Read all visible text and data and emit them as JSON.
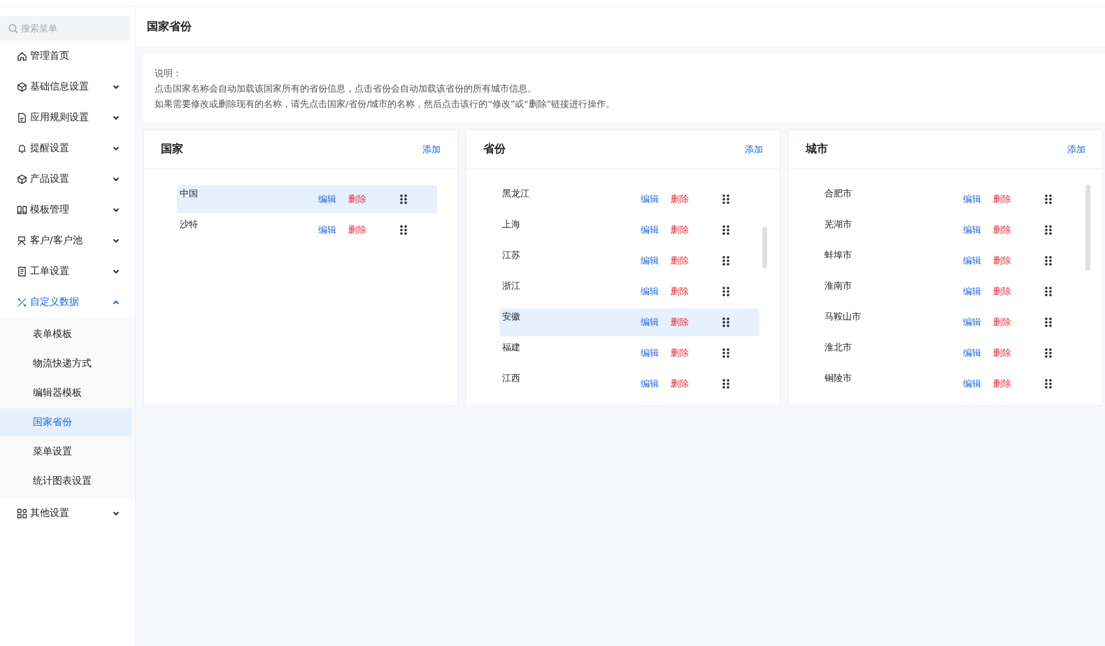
{
  "search": {
    "placeholder": "搜索菜单"
  },
  "menu": [
    {
      "label": "管理首页",
      "kind": "link",
      "selected": false
    },
    {
      "label": "基础信息设置",
      "kind": "group",
      "selected": false,
      "expanded": false
    },
    {
      "label": "应用规则设置",
      "kind": "group",
      "selected": false,
      "expanded": false
    },
    {
      "label": "提醒设置",
      "kind": "group",
      "selected": false,
      "expanded": false
    },
    {
      "label": "产品设置",
      "kind": "group",
      "selected": false,
      "expanded": false
    },
    {
      "label": "模板管理",
      "kind": "group",
      "selected": false,
      "expanded": false
    },
    {
      "label": "客户/客户池",
      "kind": "group",
      "selected": false,
      "expanded": false
    },
    {
      "label": "工单设置",
      "kind": "group",
      "selected": false,
      "expanded": false
    },
    {
      "label": "自定义数据",
      "kind": "group",
      "selected": true,
      "expanded": true,
      "children": [
        {
          "label": "表单模板",
          "selected": false
        },
        {
          "label": "物流快递方式",
          "selected": false
        },
        {
          "label": "编辑器模板",
          "selected": false
        },
        {
          "label": "国家省份",
          "selected": true
        },
        {
          "label": "菜单设置",
          "selected": false
        },
        {
          "label": "统计图表设置",
          "selected": false
        }
      ]
    },
    {
      "label": "其他设置",
      "kind": "group",
      "selected": false,
      "expanded": false
    }
  ],
  "page_title": "国家省份",
  "notice": {
    "title": "说明：",
    "lines": [
      "点击国家名称会自动加载该国家所有的省份信息，点击省份会自动加载该省份的所有城市信息。",
      "如果需要修改或删除现有的名称，请先点击国家/省份/城市的名称，然后点击该行的“修改”或“删除”链接进行操作。"
    ]
  },
  "panels": [
    {
      "title": "国家",
      "add": "添加",
      "scrollbar": false,
      "rows": [
        {
          "name": "中国",
          "edit": "编辑",
          "delete": "删除",
          "selected": true
        },
        {
          "name": "沙特",
          "edit": "编辑",
          "delete": "删除",
          "selected": false
        }
      ]
    },
    {
      "title": "省份",
      "add": "添加",
      "scrollbar": true,
      "rows": [
        {
          "name": "黑龙江",
          "edit": "编辑",
          "delete": "删除",
          "selected": false
        },
        {
          "name": "上海",
          "edit": "编辑",
          "delete": "删除",
          "selected": false
        },
        {
          "name": "江苏",
          "edit": "编辑",
          "delete": "删除",
          "selected": false
        },
        {
          "name": "浙江",
          "edit": "编辑",
          "delete": "删除",
          "selected": false
        },
        {
          "name": "安徽",
          "edit": "编辑",
          "delete": "删除",
          "selected": true
        },
        {
          "name": "福建",
          "edit": "编辑",
          "delete": "删除",
          "selected": false
        },
        {
          "name": "江西",
          "edit": "编辑",
          "delete": "删除",
          "selected": false
        }
      ]
    },
    {
      "title": "城市",
      "add": "添加",
      "scrollbar": true,
      "rows": [
        {
          "name": "合肥市",
          "edit": "编辑",
          "delete": "删除",
          "selected": false
        },
        {
          "name": "芜湖市",
          "edit": "编辑",
          "delete": "删除",
          "selected": false
        },
        {
          "name": "蚌埠市",
          "edit": "编辑",
          "delete": "删除",
          "selected": false
        },
        {
          "name": "淮南市",
          "edit": "编辑",
          "delete": "删除",
          "selected": false
        },
        {
          "name": "马鞍山市",
          "edit": "编辑",
          "delete": "删除",
          "selected": false
        },
        {
          "name": "淮北市",
          "edit": "编辑",
          "delete": "删除",
          "selected": false
        },
        {
          "name": "铜陵市",
          "edit": "编辑",
          "delete": "删除",
          "selected": false
        }
      ]
    }
  ]
}
